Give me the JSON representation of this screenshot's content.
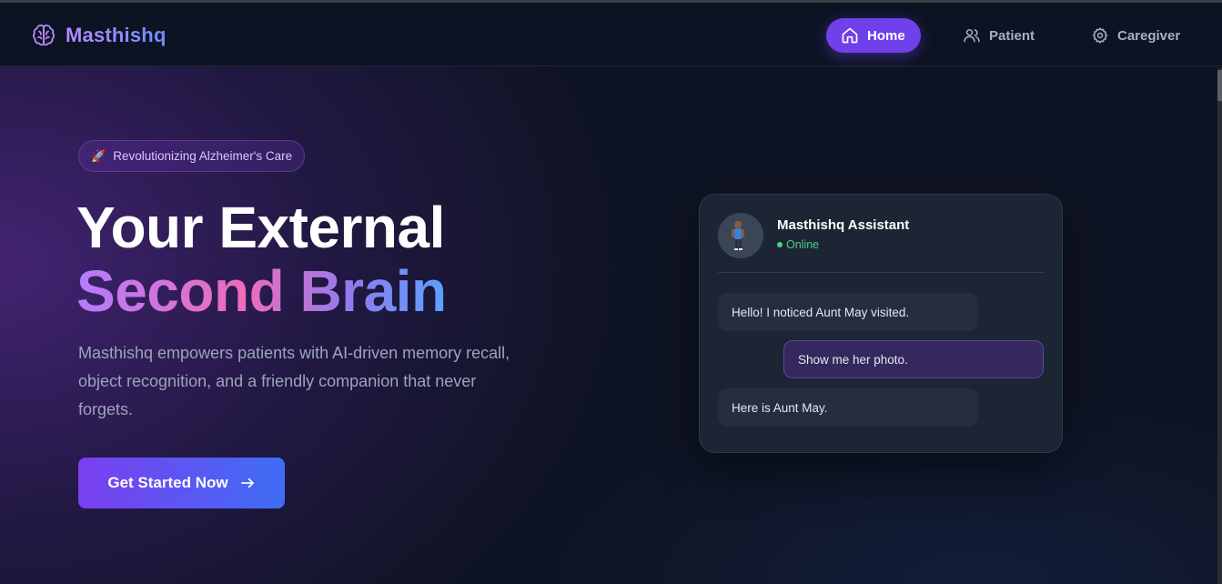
{
  "brand": {
    "name": "Masthishq",
    "icon": "brain-icon",
    "accent": "#7040ea"
  },
  "nav": {
    "items": [
      {
        "label": "Home",
        "icon": "home-icon",
        "active": true
      },
      {
        "label": "Patient",
        "icon": "users-icon",
        "active": false
      },
      {
        "label": "Caregiver",
        "icon": "gear-icon",
        "active": false
      }
    ]
  },
  "hero": {
    "badge": {
      "icon": "rocket-icon",
      "text": "Revolutionizing Alzheimer's Care"
    },
    "headline_line1": "Your External",
    "headline_line2": "Second Brain",
    "subtitle": "Masthishq empowers patients with AI-driven memory recall, object recognition, and a friendly companion that never forgets.",
    "cta": {
      "label": "Get Started Now",
      "icon": "arrow-right-icon"
    }
  },
  "chat": {
    "assistant_name": "Masthishq Assistant",
    "status": "Online",
    "status_color": "#4ad281",
    "messages": [
      {
        "from": "bot",
        "text": "Hello! I noticed Aunt May visited."
      },
      {
        "from": "user",
        "text": "Show me her photo."
      },
      {
        "from": "bot",
        "text": "Here is Aunt May."
      }
    ]
  }
}
